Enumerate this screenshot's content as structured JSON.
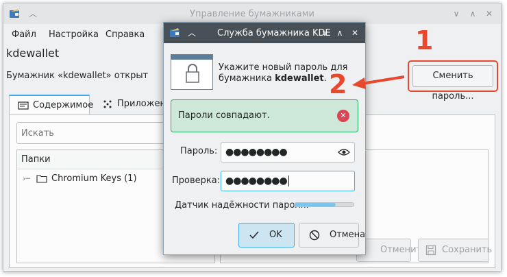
{
  "main_window": {
    "title": "Управление бумажниками",
    "menu": [
      "Файл",
      "Настройка",
      "Справка"
    ],
    "wallet_name": "kdewallet",
    "wallet_status": "Бумажник «kdewallet» открыт",
    "change_password_button": "Сменить пароль...",
    "tabs": [
      {
        "label": "Содержимое",
        "active": true
      },
      {
        "label": "Приложения",
        "active": false
      }
    ],
    "search_placeholder": "Искать",
    "folders_header": "Папки",
    "folders": [
      {
        "label": "Chromium Keys (1)"
      }
    ],
    "revert_button": "Отменить",
    "save_button": "Сохранить"
  },
  "dialog": {
    "title": "Служба бумажника KDE",
    "message_prefix": "Укажите новый пароль для бумажника ",
    "message_wallet": "kdewallet",
    "message_suffix": ".",
    "match_message": "Пароли совпадают.",
    "password_label": "Пароль:",
    "password_value": "●●●●●●●●",
    "verify_label": "Проверка:",
    "verify_value": "●●●●●●●●",
    "strength_label": "Датчик надёжности пароля:",
    "strength_percent": 70,
    "ok_button": "OK",
    "cancel_button": "Отмена"
  },
  "annotations": {
    "step1": "1",
    "step2": "2",
    "color": "#e8482e"
  },
  "colors": {
    "accent": "#3daee9",
    "success_bg": "#cde8d8",
    "success_border": "#27ae60",
    "dialog_titlebar": "#475057"
  }
}
